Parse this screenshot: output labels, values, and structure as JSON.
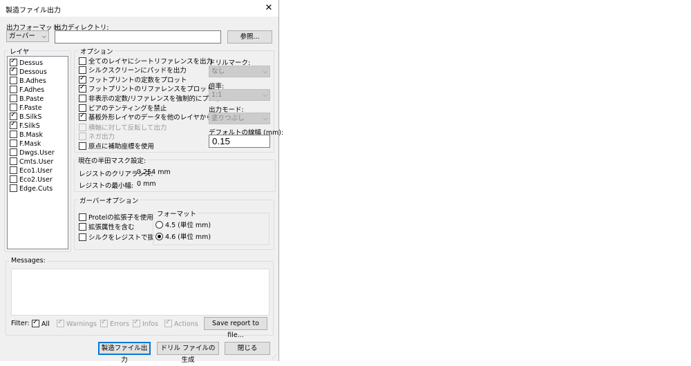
{
  "window": {
    "title": "製造ファイル出力",
    "close_glyph": "✕"
  },
  "format": {
    "label": "出力フォーマット:",
    "value": "ガーバー"
  },
  "output_dir": {
    "label": "出力ディレクトリ:",
    "value": "",
    "browse": "参照..."
  },
  "layers": {
    "title": "レイヤ",
    "items": [
      {
        "name": "Dessus",
        "checked": true
      },
      {
        "name": "Dessous",
        "checked": true
      },
      {
        "name": "B.Adhes",
        "checked": false
      },
      {
        "name": "F.Adhes",
        "checked": false
      },
      {
        "name": "B.Paste",
        "checked": false
      },
      {
        "name": "F.Paste",
        "checked": false
      },
      {
        "name": "B.SilkS",
        "checked": true
      },
      {
        "name": "F.SilkS",
        "checked": true
      },
      {
        "name": "B.Mask",
        "checked": false
      },
      {
        "name": "F.Mask",
        "checked": false
      },
      {
        "name": "Dwgs.User",
        "checked": false
      },
      {
        "name": "Cmts.User",
        "checked": false
      },
      {
        "name": "Eco1.User",
        "checked": false
      },
      {
        "name": "Eco2.User",
        "checked": false
      },
      {
        "name": "Edge.Cuts",
        "checked": false
      }
    ]
  },
  "options": {
    "title": "オプション",
    "items": [
      {
        "label": "全てのレイヤにシートリファレンスを出力",
        "checked": false,
        "disabled": false
      },
      {
        "label": "シルクスクリーンにパッドを出力",
        "checked": false,
        "disabled": false
      },
      {
        "label": "フットプリントの定数をプロット",
        "checked": true,
        "disabled": false
      },
      {
        "label": "フットプリントのリファレンスをプロット",
        "checked": true,
        "disabled": false
      },
      {
        "label": "非表示の定数/リファレンスを強制的にプロット",
        "checked": false,
        "disabled": false
      },
      {
        "label": "ビアのテンティングを禁止",
        "checked": false,
        "disabled": false
      },
      {
        "label": "基板外形レイヤのデータを他のレイヤから除外",
        "checked": true,
        "disabled": false
      },
      {
        "label": "横軸に対して反転して出力",
        "checked": false,
        "disabled": true
      },
      {
        "label": "ネガ出力",
        "checked": false,
        "disabled": true
      },
      {
        "label": "原点に補助座標を使用",
        "checked": false,
        "disabled": false
      }
    ],
    "drill_mark": {
      "label": "ドリルマーク:",
      "value": "なし"
    },
    "scale": {
      "label": "倍率:",
      "value": "1:1"
    },
    "mode": {
      "label": "出力モード:",
      "value": "塗りつぶし"
    },
    "line_width": {
      "label": "デフォルトの線幅 (mm):",
      "value": "0.15"
    }
  },
  "mask": {
    "title": "現在の半田マスク設定:",
    "clearance_label": "レジストのクリアランス:",
    "clearance_value": "0.254 mm",
    "minwidth_label": "レジストの最小幅:",
    "minwidth_value": "0 mm"
  },
  "gerber": {
    "title": "ガーバーオプション",
    "items": [
      {
        "label": "Protelの拡張子を使用",
        "checked": false
      },
      {
        "label": "拡張属性を含む",
        "checked": false
      },
      {
        "label": "シルクをレジストで抜く",
        "checked": false
      }
    ],
    "format_title": "フォーマット",
    "radios": [
      {
        "label": "4.5 (単位 mm)",
        "selected": false
      },
      {
        "label": "4.6 (単位 mm)",
        "selected": true
      }
    ]
  },
  "messages": {
    "title": "Messages:",
    "filter_label": "Filter:",
    "filters": [
      {
        "label": "All",
        "checked": true,
        "disabled": false
      },
      {
        "label": "Warnings",
        "checked": true,
        "disabled": true
      },
      {
        "label": "Errors",
        "checked": true,
        "disabled": true
      },
      {
        "label": "Infos",
        "checked": true,
        "disabled": true
      },
      {
        "label": "Actions",
        "checked": true,
        "disabled": true
      }
    ],
    "save_button": "Save report to file..."
  },
  "footer": {
    "plot": "製造ファイル出力",
    "drill": "ドリル ファイルの生成",
    "close": "閉じる"
  }
}
